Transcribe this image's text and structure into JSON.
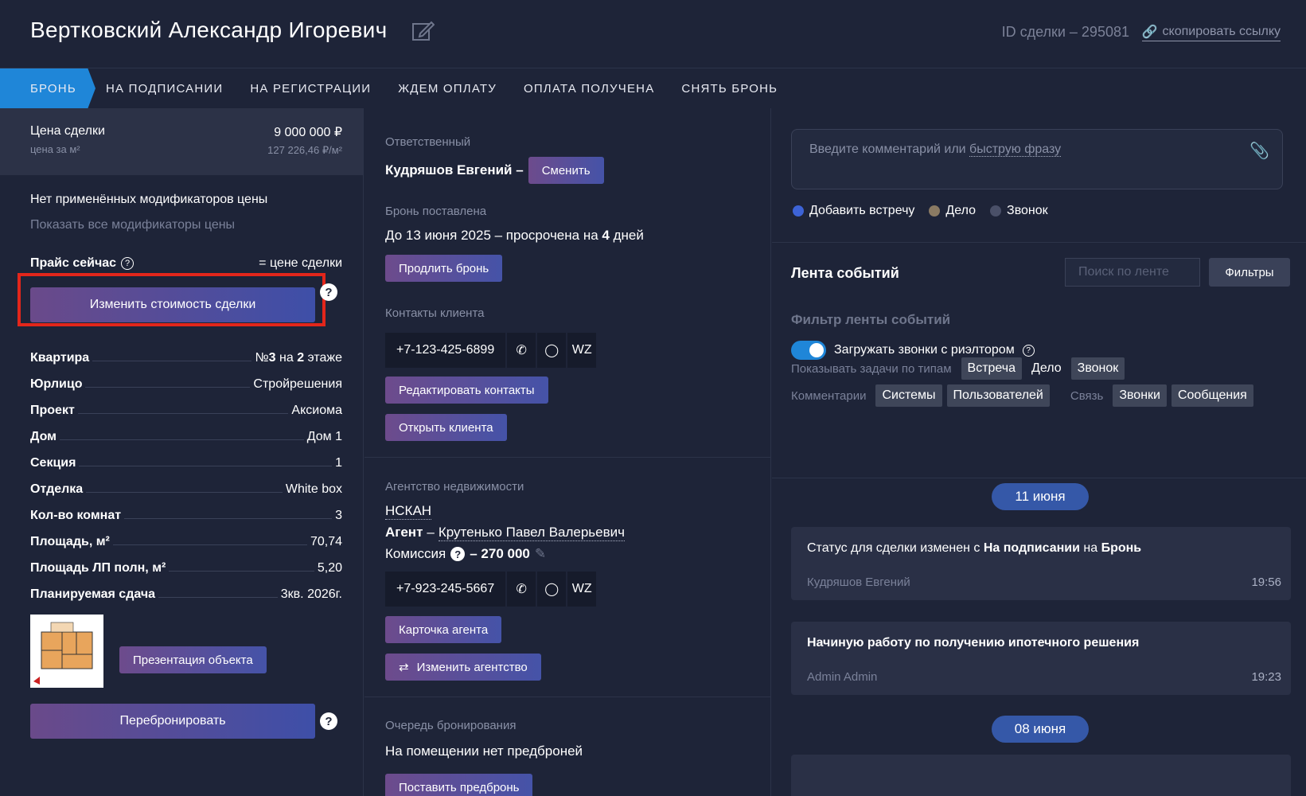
{
  "header": {
    "title": "Вертковский Александр Игоревич",
    "deal_id": "ID сделки – 295081",
    "copy_link": "скопировать ссылку"
  },
  "tabs": [
    {
      "label": "БРОНЬ",
      "active": true
    },
    {
      "label": "НА ПОДПИСАНИИ"
    },
    {
      "label": "НА РЕГИСТРАЦИИ"
    },
    {
      "label": "ЖДЕМ ОПЛАТУ"
    },
    {
      "label": "ОПЛАТА ПОЛУЧЕНА"
    },
    {
      "label": "СНЯТЬ БРОНЬ"
    }
  ],
  "left": {
    "price_label": "Цена сделки",
    "price_value": "9 000 000 ₽",
    "per_m2_label": "цена за м²",
    "per_m2_value": "127 226,46 ₽/м²",
    "no_modifiers": "Нет применённых модификаторов цены",
    "show_modifiers": "Показать все модификаторы цены",
    "price_now_label": "Прайс сейчас",
    "price_now_value": "= цене сделки",
    "change_price_btn": "Изменить стоимость сделки",
    "props": [
      {
        "k": "Квартира",
        "v_html_parts": [
          "№",
          "3",
          " на ",
          "2",
          " этаже"
        ]
      },
      {
        "k": "Юрлицо",
        "v": "Стройрешения"
      },
      {
        "k": "Проект",
        "v": "Аксиома"
      },
      {
        "k": "Дом",
        "v": "Дом 1"
      },
      {
        "k": "Секция",
        "v": "1"
      },
      {
        "k": "Отделка",
        "v": "White box"
      },
      {
        "k": "Кол-во комнат",
        "v": "3"
      },
      {
        "k": "Площадь, м²",
        "v": "70,74"
      },
      {
        "k": "Площадь ЛП полн, м²",
        "v": "5,20"
      },
      {
        "k": "Планируемая сдача",
        "v": "3кв. 2026г."
      }
    ],
    "presentation_btn": "Презентация объекта",
    "rebook_btn": "Перебронировать"
  },
  "mid": {
    "responsible_label": "Ответственный",
    "responsible_name": "Кудряшов Евгений –",
    "change_btn": "Сменить",
    "booking_label": "Бронь поставлена",
    "booking_text_pre": "До 13 июня 2025 – просрочена на ",
    "booking_days": "4",
    "booking_text_post": " дней",
    "extend_btn": "Продлить бронь",
    "contacts_label": "Контакты клиента",
    "client_phone": "+7-123-425-6899",
    "wz": "WZ",
    "edit_contacts_btn": "Редактировать контакты",
    "open_client_btn": "Открыть клиента",
    "agency_label": "Агентство недвижимости",
    "agency_name": "НСКАН",
    "agent_label": "Агент",
    "agent_name": "Крутенько Павел Валерьевич",
    "commission_label": "Комиссия",
    "commission_value": "– 270 000",
    "agent_phone": "+7-923-245-5667",
    "agent_card_btn": "Карточка агента",
    "change_agency_btn": "Изменить агентство",
    "queue_label": "Очередь бронирования",
    "queue_text": "На помещении нет предброней",
    "prebook_btn": "Поставить предбронь"
  },
  "right": {
    "comment_placeholder": "Введите комментарий или ",
    "comment_link": "быструю фразу",
    "radios": [
      {
        "label": "Добавить встречу",
        "color": "#3d63d6"
      },
      {
        "label": "Дело",
        "color": "#8a7a63"
      },
      {
        "label": "Звонок",
        "color": "#4a5068"
      }
    ],
    "feed_title": "Лента событий",
    "feed_search_placeholder": "Поиск по ленте",
    "filters_btn": "Фильтры",
    "filter_title": "Фильтр ленты событий",
    "toggle_label": "Загружать звонки с риэлтором",
    "task_types_label": "Показывать задачи по типам",
    "task_types": [
      "Встреча",
      "Дело",
      "Звонок"
    ],
    "comments_label": "Комментарии",
    "comments_types": [
      "Системы",
      "Пользователей"
    ],
    "link_label": "Связь",
    "link_types": [
      "Звонки",
      "Сообщения"
    ],
    "date1": "11 июня",
    "event1": {
      "pre": "Статус для сделки изменен с ",
      "from": "На подписании",
      "mid": " на ",
      "to": "Бронь",
      "author": "Кудряшов Евгений",
      "time": "19:56"
    },
    "event2": {
      "title": "Начиную работу по получению ипотечного решения",
      "author": "Admin Admin",
      "time": "19:23"
    },
    "date2": "08 июня"
  }
}
